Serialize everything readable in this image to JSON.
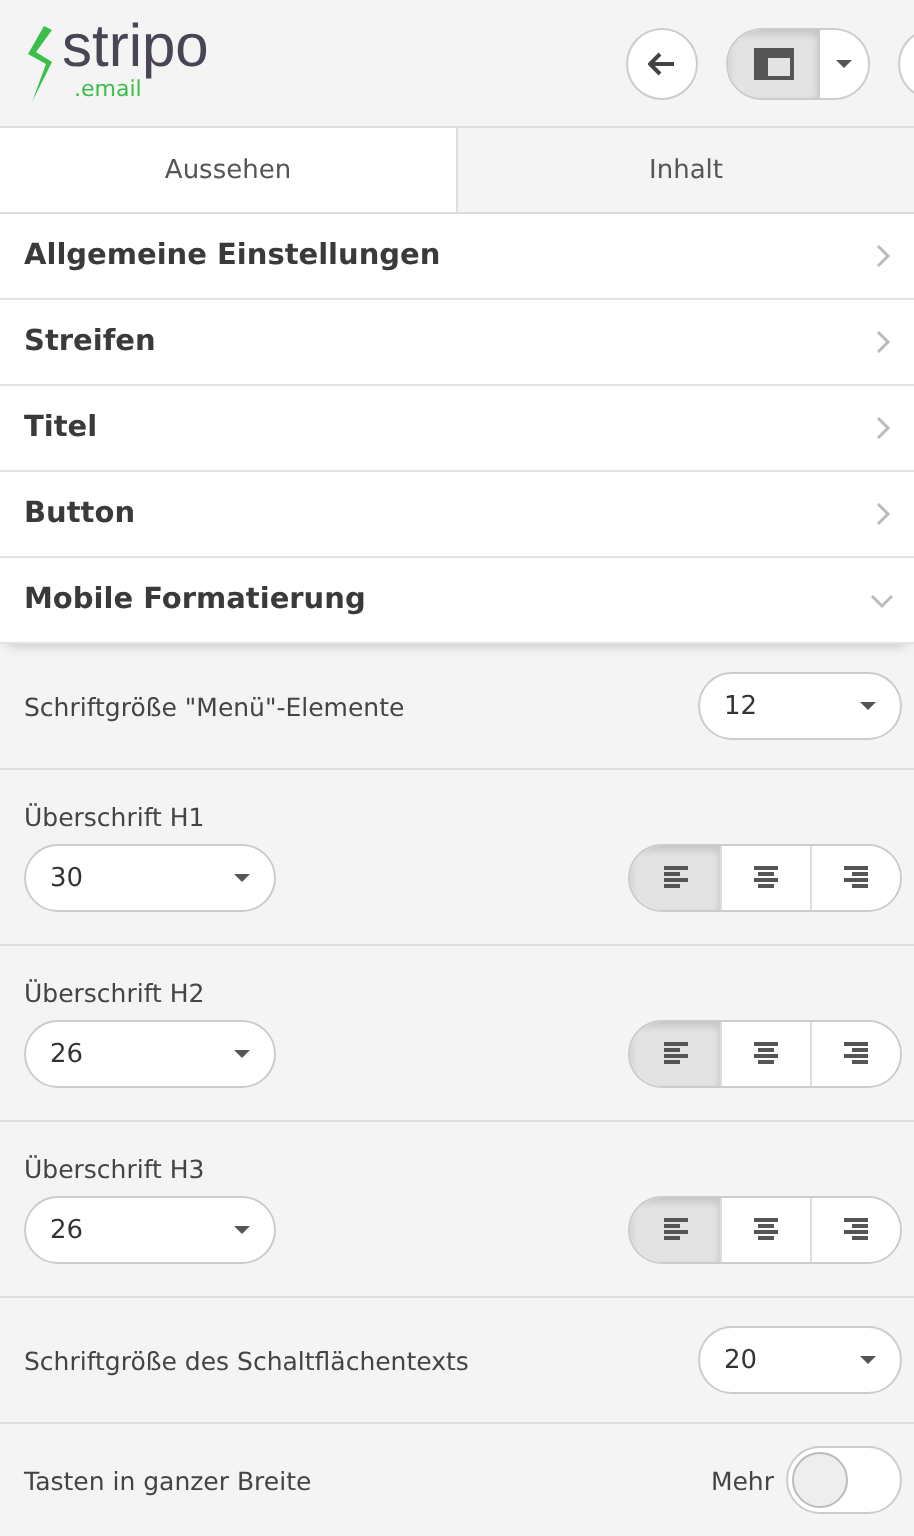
{
  "logo": {
    "word": "stripo",
    "suffix": ".email"
  },
  "tabs": [
    {
      "label": "Aussehen",
      "selected": true
    },
    {
      "label": "Inhalt",
      "selected": false
    }
  ],
  "sections": [
    {
      "label": "Allgemeine Einstellungen",
      "expanded": false
    },
    {
      "label": "Streifen",
      "expanded": false
    },
    {
      "label": "Titel",
      "expanded": false
    },
    {
      "label": "Button",
      "expanded": false
    },
    {
      "label": "Mobile Formatierung",
      "expanded": true
    }
  ],
  "settings": [
    {
      "kind": "inline-select",
      "label": "Schriftgröße \"Menü\"-Elemente",
      "value": "12"
    },
    {
      "kind": "heading",
      "label": "Überschrift H1",
      "value": "30",
      "align": [
        {
          "selected": true
        },
        {
          "selected": false
        },
        {
          "selected": false
        }
      ]
    },
    {
      "kind": "heading",
      "label": "Überschrift H2",
      "value": "26",
      "align": [
        {
          "selected": true
        },
        {
          "selected": false
        },
        {
          "selected": false
        }
      ]
    },
    {
      "kind": "heading",
      "label": "Überschrift H3",
      "value": "26",
      "align": [
        {
          "selected": true
        },
        {
          "selected": false
        },
        {
          "selected": false
        }
      ]
    },
    {
      "kind": "inline-select",
      "label": "Schriftgröße des Schaltflächentexts",
      "value": "20"
    },
    {
      "kind": "toggle",
      "label": "Tasten in ganzer Breite",
      "side_label": "Mehr",
      "on": false
    }
  ]
}
